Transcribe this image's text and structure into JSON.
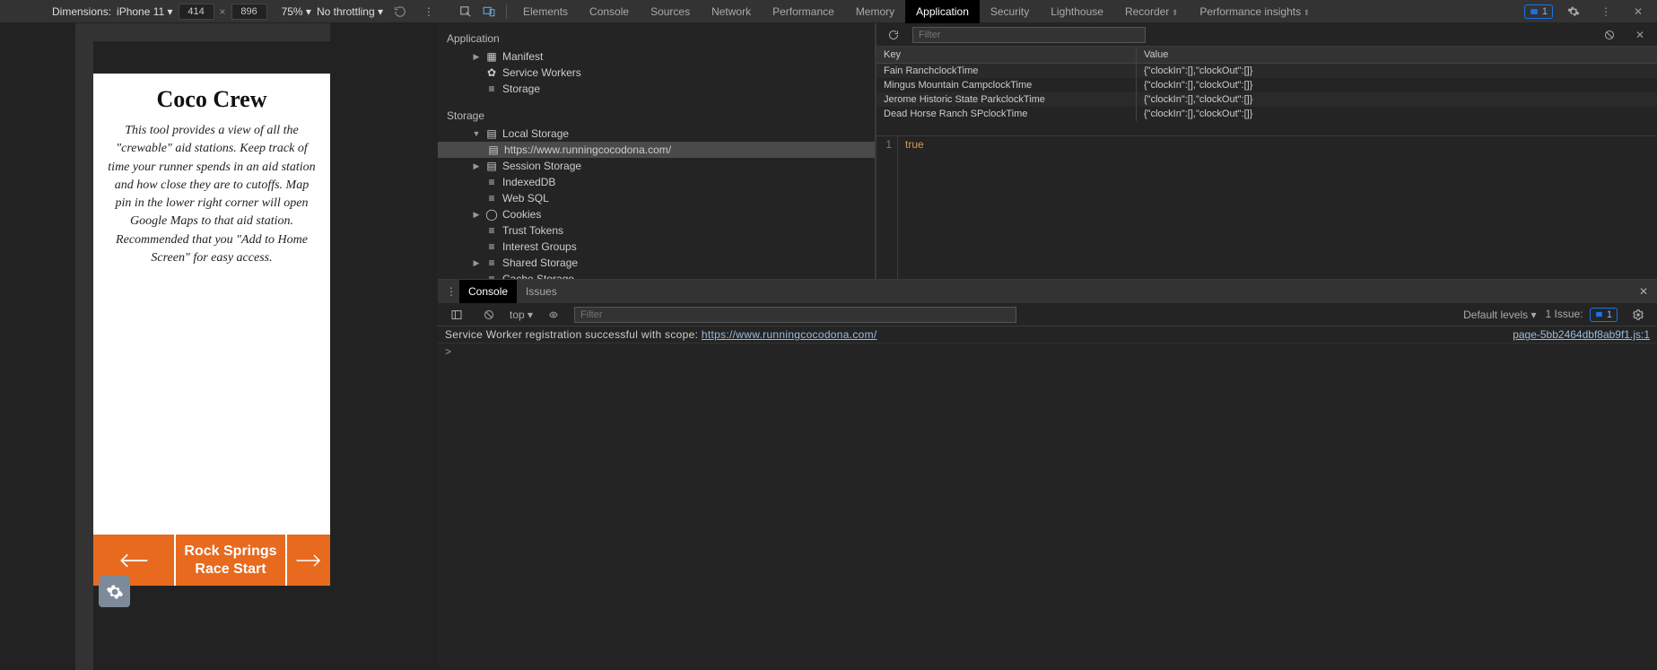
{
  "deviceToolbar": {
    "dimensionsLabel": "Dimensions:",
    "device": "iPhone 11",
    "width": "414",
    "height": "896",
    "zoom": "75%",
    "throttling": "No throttling"
  },
  "panelTabs": [
    "Elements",
    "Console",
    "Sources",
    "Network",
    "Performance",
    "Memory",
    "Application",
    "Security",
    "Lighthouse",
    "Recorder",
    "Performance insights"
  ],
  "activePanel": "Application",
  "issuesTop": "1",
  "app": {
    "title": "Coco Crew",
    "description": "This tool provides a view of all the \"crewable\" aid stations. Keep track of time your runner spends in an aid station and how close they are to cutoffs. Map pin in the lower right corner will open Google Maps to that aid station. Recommended that you \"Add to Home Screen\" for easy access.",
    "footerLine1": "Rock Springs",
    "footerLine2": "Race Start"
  },
  "sidebar": {
    "appHead": "Application",
    "appItems": [
      "Manifest",
      "Service Workers",
      "Storage"
    ],
    "storageHead": "Storage",
    "localStorage": "Local Storage",
    "localStorageOrigin": "https://www.runningcocodona.com/",
    "sessionStorage": "Session Storage",
    "indexedDB": "IndexedDB",
    "webSQL": "Web SQL",
    "cookies": "Cookies",
    "trustTokens": "Trust Tokens",
    "interestGroups": "Interest Groups",
    "sharedStorage": "Shared Storage",
    "cacheStorage": "Cache Storage"
  },
  "storageToolbar": {
    "filterPlaceholder": "Filter"
  },
  "kv": {
    "keyHead": "Key",
    "valHead": "Value",
    "rows": [
      {
        "k": "Fain RanchclockTime",
        "v": "{\"clockIn\":[],\"clockOut\":[]}"
      },
      {
        "k": "Mingus Mountain CampclockTime",
        "v": "{\"clockIn\":[],\"clockOut\":[]}"
      },
      {
        "k": "Jerome Historic State ParkclockTime",
        "v": "{\"clockIn\":[],\"clockOut\":[]}"
      },
      {
        "k": "Dead Horse Ranch SPclockTime",
        "v": "{\"clockIn\":[],\"clockOut\":[]}"
      }
    ]
  },
  "valuePreview": {
    "line": "1",
    "text": "true"
  },
  "drawer": {
    "tabs": [
      "Console",
      "Issues"
    ],
    "activeTab": "Console",
    "context": "top",
    "filterPlaceholder": "Filter",
    "levels": "Default levels",
    "issueLabel": "1 Issue:",
    "issueCount": "1"
  },
  "console": {
    "msgPrefix": "Service Worker registration successful with scope:  ",
    "msgLink": "https://www.runningcocodona.com/",
    "source": "page-5bb2464dbf8ab9f1.js:1",
    "prompt": ">"
  }
}
